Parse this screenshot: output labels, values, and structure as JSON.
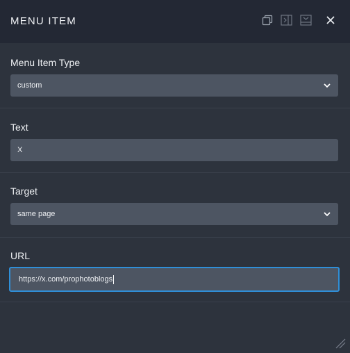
{
  "header": {
    "title": "MENU ITEM",
    "icons": [
      "duplicate-icon",
      "collapse-panel-icon",
      "minimize-icon",
      "close-icon"
    ]
  },
  "fields": {
    "menu_item_type": {
      "label": "Menu Item Type",
      "value": "custom"
    },
    "text": {
      "label": "Text",
      "value": "X"
    },
    "target": {
      "label": "Target",
      "value": "same page"
    },
    "url": {
      "label": "URL",
      "value": "https://x.com/prophotoblogs"
    }
  },
  "colors": {
    "background": "#2d333d",
    "titlebar": "#232834",
    "control": "#4d5562",
    "focus_border": "#2f8fd8"
  }
}
